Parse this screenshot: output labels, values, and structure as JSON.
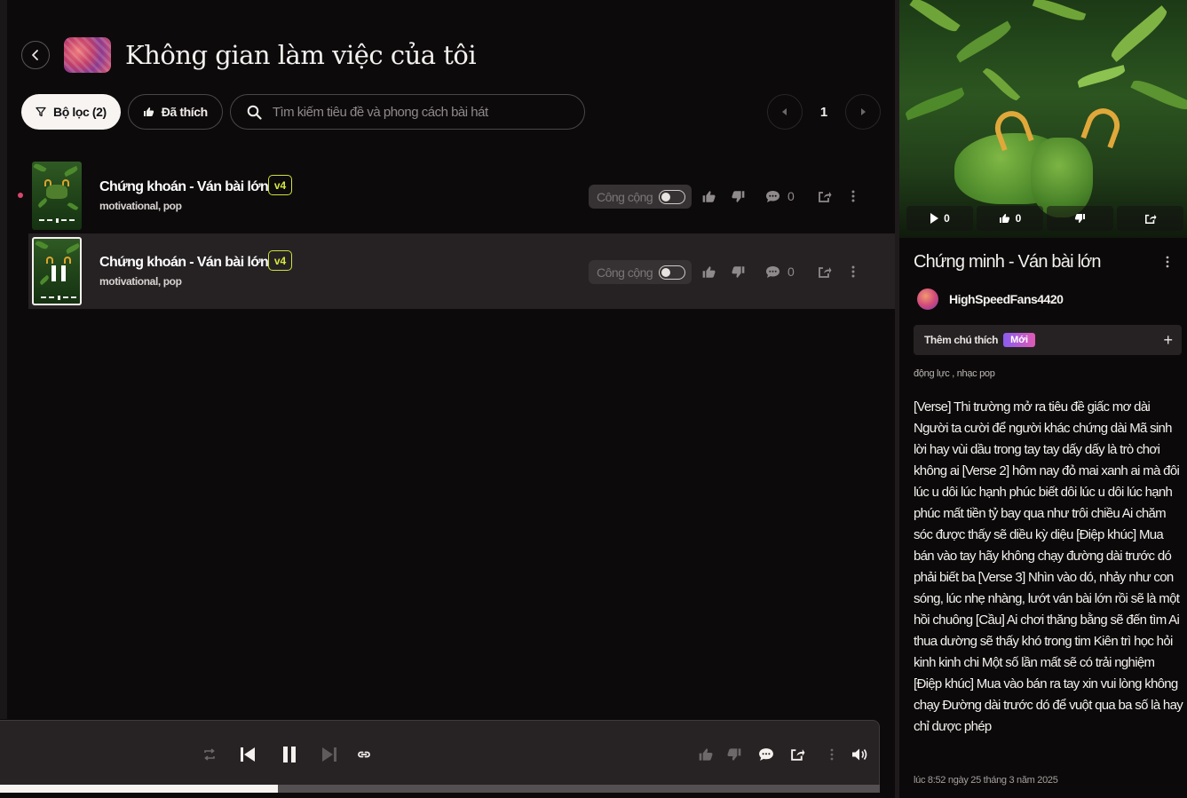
{
  "workspace": {
    "title": "Không gian làm việc của tôi"
  },
  "toolbar": {
    "filter_label": "Bộ lọc (2)",
    "liked_label": "Đã thích",
    "search_placeholder": "Tìm kiếm tiêu đề và phong cách bài hát",
    "page": "1"
  },
  "songs": [
    {
      "title": "Chứng khoán - Ván bài lớn",
      "version": "v4",
      "tags": "motivational, pop",
      "visibility_label": "Công cộng",
      "comments": "0",
      "playing": false
    },
    {
      "title": "Chứng khoán - Ván bài lớn",
      "version": "v4",
      "tags": "motivational, pop",
      "visibility_label": "Công cộng",
      "comments": "0",
      "playing": true
    }
  ],
  "player": {
    "progress": 0.316
  },
  "detail": {
    "plays": "0",
    "likes": "0",
    "title": "Chứng minh - Ván bài lớn",
    "author": "HighSpeedFans4420",
    "add_annotation_label": "Thêm chú thích",
    "new_badge": "Mới",
    "tags": "động lực , nhạc pop",
    "lyrics": "[Verse] Thi trường mở ra tiêu đề giấc mơ dài Người ta cười để người khác chứng dài Mã sinh lời hay vùi dầu trong tay tay dấy dấy là trò chơi không ai [Verse 2] hôm nay đỏ mai xanh ai mà đôi lúc u dôi lúc hạnh phúc biết dôi lúc u dôi lúc hạnh phúc mất tiền tỷ bay qua như trôi chiều Ai chăm sóc được thấy sẽ diều kỳ diệu [Điệp khúc] Mua bán vào tay hãy không chạy đường dài trước dó phải biết ba [Verse 3] Nhìn vào dó, nhảy như con sóng, lúc nhẹ nhàng, lướt ván bài lớn rồi sẽ là một hồi chuông [Cầu] Ai chơi thăng bằng sẽ đến tìm Ai thua dường sẽ thấy khó trong tim Kiên trì học hỏi kinh kinh chi Một số lần mất sẽ có trải nghiệm [Điệp khúc] Mua vào bán ra tay xin vui lòng không chạy Đường dài trước dó để vuột qua ba số là hay chỉ dược phép",
    "timestamp": "lúc 8:52 ngày 25 tháng 3 năm 2025"
  },
  "colors": {
    "accent_badge": "#d7e93f",
    "dot": "#d6476e",
    "background": "#0d0a0b"
  }
}
